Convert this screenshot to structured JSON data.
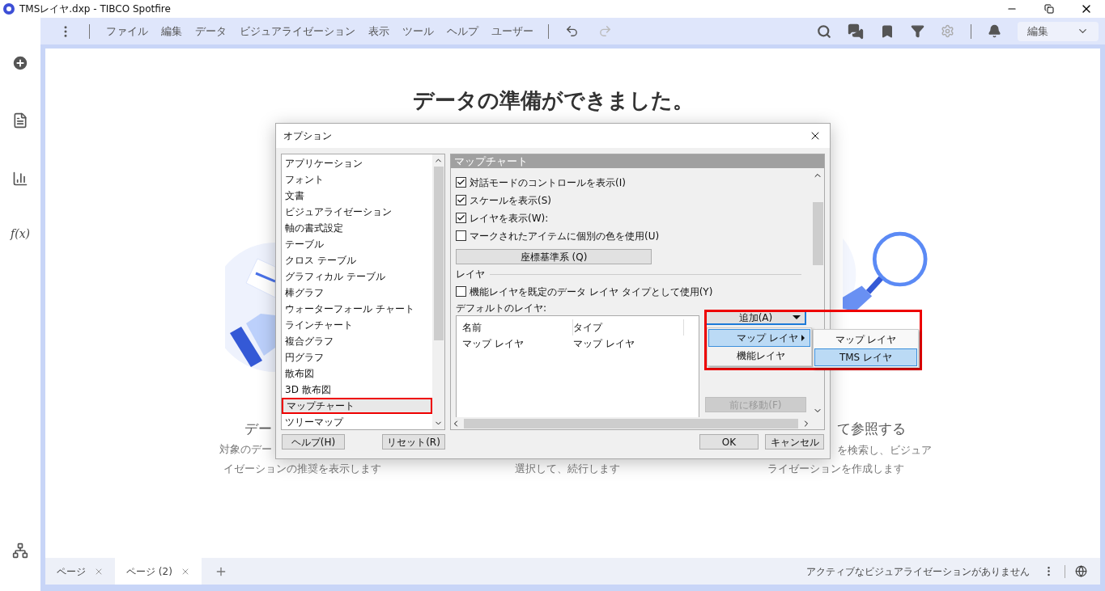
{
  "window": {
    "title": "TMSレイヤ.dxp - TIBCO Spotfire"
  },
  "menu": [
    {
      "label": "ファイル"
    },
    {
      "label": "編集"
    },
    {
      "label": "データ"
    },
    {
      "label": "ビジュアライゼーション"
    },
    {
      "label": "表示"
    },
    {
      "label": "ツール"
    },
    {
      "label": "ヘルプ"
    },
    {
      "label": "ユーザー"
    }
  ],
  "mode_select": {
    "value": "編集"
  },
  "sidebar": {
    "formula_label": "f(x)"
  },
  "page": {
    "heading": "データの準備ができました。",
    "cards": [
      {
        "title": "デー",
        "description": [
          "対象のデー",
          "イゼーションの推奨を表示します"
        ]
      },
      {
        "description": [
          "選択して、続行します"
        ]
      },
      {
        "title": "て参照する",
        "description": [
          "を検索し、ビジュア",
          "ライゼーションを作成します"
        ]
      }
    ]
  },
  "dialog": {
    "title": "オプション",
    "categories": [
      {
        "label": "アプリケーション",
        "selected": false
      },
      {
        "label": "フォント",
        "selected": false
      },
      {
        "label": "文書",
        "selected": false
      },
      {
        "label": "ビジュアライゼーション",
        "selected": false
      },
      {
        "label": "軸の書式設定",
        "selected": false
      },
      {
        "label": "テーブル",
        "selected": false
      },
      {
        "label": "クロス テーブル",
        "selected": false
      },
      {
        "label": "グラフィカル テーブル",
        "selected": false
      },
      {
        "label": "棒グラフ",
        "selected": false
      },
      {
        "label": "ウォーターフォール チャート",
        "selected": false
      },
      {
        "label": "ラインチャート",
        "selected": false
      },
      {
        "label": "複合グラフ",
        "selected": false
      },
      {
        "label": "円グラフ",
        "selected": false
      },
      {
        "label": "散布図",
        "selected": false
      },
      {
        "label": "3D 散布図",
        "selected": false
      },
      {
        "label": "マップチャート",
        "selected": true
      },
      {
        "label": "ツリーマップ",
        "selected": false
      }
    ],
    "help_button": "ヘルプ(H)",
    "reset_button": "リセット(R)",
    "section_title": "マップチャート",
    "options": [
      {
        "label": "対話モードのコントロールを表示(I)",
        "checked": true
      },
      {
        "label": "スケールを表示(S)",
        "checked": true
      },
      {
        "label": "レイヤを表示(W):",
        "checked": true
      },
      {
        "label": "マークされたアイテムに個別の色を使用(U)",
        "checked": false
      }
    ],
    "crs_button": "座標基準系 (Q)",
    "layer_group": "レイヤ",
    "feature_option": {
      "label": "機能レイヤを既定のデータ レイヤ タイプとして使用(Y)",
      "checked": false
    },
    "default_layers_label": "デフォルトのレイヤ:",
    "table": {
      "columns": [
        "名前",
        "タイプ"
      ],
      "rows": [
        [
          "マップ レイヤ",
          "マップ レイヤ"
        ]
      ]
    },
    "add_button": "追加(A)",
    "move_up_button": {
      "label": "前に移動(F)",
      "disabled": true
    },
    "ok_button": "OK",
    "cancel_button": "キャンセル"
  },
  "add_menu": {
    "items": [
      {
        "label": "マップ レイヤ",
        "selected": true,
        "has_submenu": true
      },
      {
        "label": "機能レイヤ",
        "selected": false,
        "has_submenu": false
      }
    ]
  },
  "submenu": {
    "items": [
      {
        "label": "マップ レイヤ",
        "selected": false
      },
      {
        "label": "TMS レイヤ",
        "selected": true
      }
    ]
  },
  "page_tabs": [
    {
      "label": "ページ",
      "selected": false
    },
    {
      "label": "ページ (2)",
      "selected": true
    }
  ],
  "status": "アクティブなビジュアライゼーションがありません"
}
